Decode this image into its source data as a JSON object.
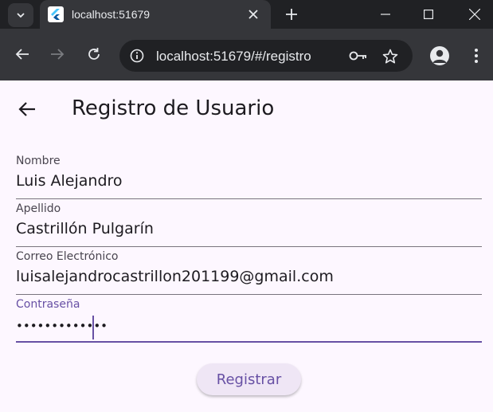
{
  "browser": {
    "tab_title": "localhost:51679",
    "url": "localhost:51679/#/registro"
  },
  "app": {
    "title": "Registro de Usuario",
    "fields": [
      {
        "label": "Nombre",
        "value": "Luis Alejandro"
      },
      {
        "label": "Apellido",
        "value": "Castrillón Pulgarín"
      },
      {
        "label": "Correo Electrónico",
        "value": "luisalejandrocastrillon201199@gmail.com"
      },
      {
        "label": "Contraseña",
        "value": "•••••••••••••"
      }
    ],
    "submit_label": "Registrar"
  },
  "colors": {
    "primary": "#6750a4",
    "background": "#fdf7ff",
    "chrome_dark": "#202124",
    "chrome_toolbar": "#35363a"
  },
  "icons": [
    "tab-search-icon",
    "flutter-favicon",
    "close-icon",
    "plus-icon",
    "minimize-icon",
    "maximize-icon",
    "back-arrow-icon",
    "forward-arrow-icon",
    "reload-icon",
    "site-info-icon",
    "key-icon",
    "star-icon",
    "profile-icon",
    "more-vert-icon"
  ]
}
